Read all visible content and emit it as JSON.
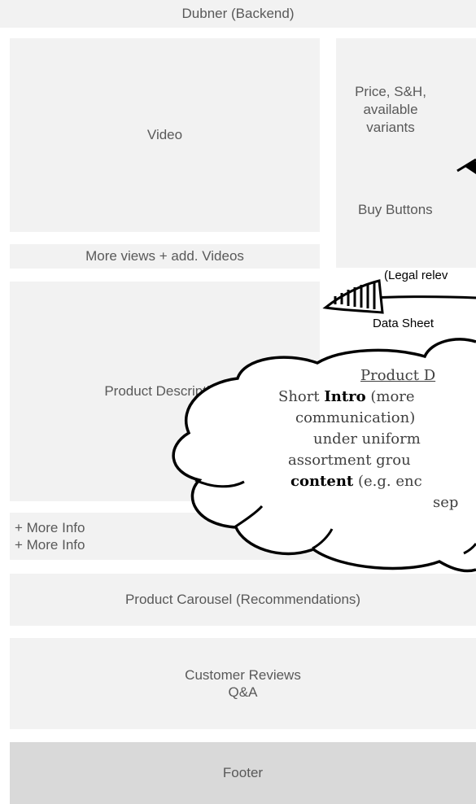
{
  "header": {
    "title": "Dubner (Backend)"
  },
  "video": {
    "label": "Video"
  },
  "more_views": {
    "label": "More views + add. Videos"
  },
  "right_panel": {
    "price_line1": "Price, S&H,",
    "price_line2": "available",
    "price_line3": "variants",
    "buy_buttons": "Buy Buttons"
  },
  "annotations": {
    "legal": "(Legal relev",
    "data_sheet": "Data Sheet"
  },
  "product_description": {
    "label": "Product Description"
  },
  "more_info": {
    "line1": "+ More Info",
    "line2": "+ More Info"
  },
  "carousel": {
    "label": "Product Carousel (Recommendations)"
  },
  "reviews": {
    "line1": "Customer Reviews",
    "line2": "Q&A"
  },
  "footer": {
    "label": "Footer"
  },
  "cloud": {
    "line1": "Product D",
    "line2_pre": "Short ",
    "line2_bold": "Intro",
    "line2_post": " (more",
    "line3": "communication)",
    "line4": "under uniform",
    "line5": "assortment grou",
    "line6_bold": "content",
    "line6_post": " (e.g. enc",
    "line7": "sep"
  },
  "colors": {
    "box_fill": "#f2f2f2",
    "footer_fill": "#d9d9d9",
    "text": "#595959"
  }
}
